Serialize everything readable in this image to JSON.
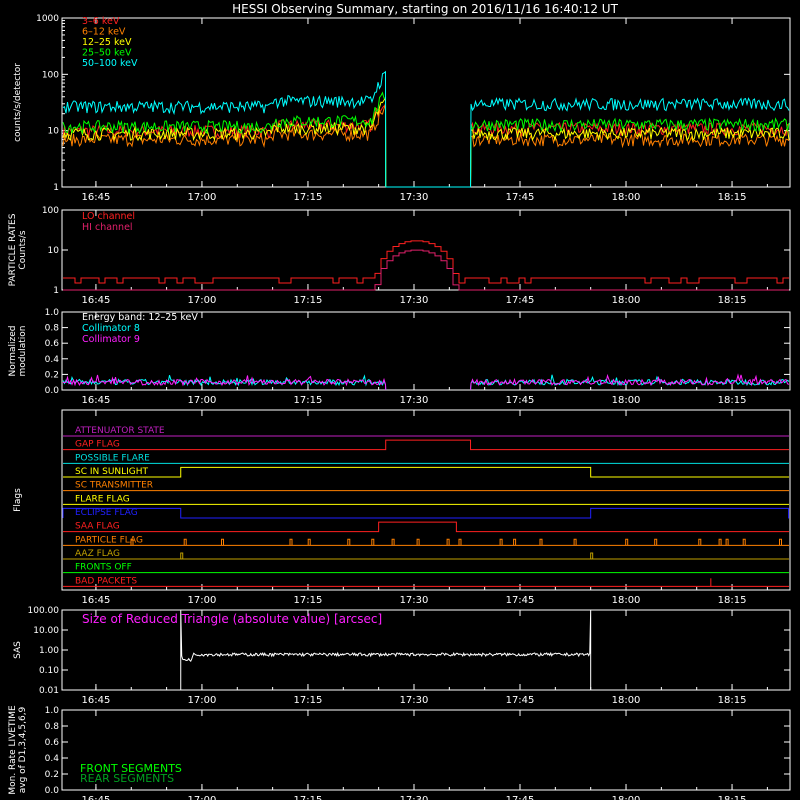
{
  "title": "HESSI Observing Summary, starting on 2016/11/16 16:40:12 UT",
  "x_tick_labels": [
    "16:45",
    "17:00",
    "17:15",
    "17:30",
    "17:45",
    "18:00",
    "18:15"
  ],
  "colors": {
    "c3_6": "#ff2020",
    "c6_12": "#ff8000",
    "c12_25": "#ffff00",
    "c25_50": "#00ff00",
    "c50_100": "#00ffff",
    "lo": "#ff2020",
    "hi": "#e0206a",
    "coll8": "#00ffff",
    "coll9": "#ff20ff",
    "white": "#ffffff",
    "flag_att": "#c020c0",
    "flag_gap": "#ff2020",
    "flag_poss": "#00e0e0",
    "flag_sun": "#ffff00",
    "flag_sct": "#ff8000",
    "flag_flare": "#ffff00",
    "flag_eclipse": "#2020ff",
    "flag_saa": "#ff2020",
    "flag_particle": "#ff8000",
    "flag_aaz": "#c0a000",
    "flag_fronts": "#00ff00",
    "flag_bad": "#ff2020",
    "front_seg": "#00ff00",
    "rear_seg": "#00a020"
  },
  "chart_data": [
    {
      "type": "line",
      "panel": "count rates",
      "ylabel": "counts/s/detector",
      "yscale": "log",
      "ylim": [
        1,
        1000
      ],
      "y_tick_labels": [
        "1",
        "10",
        "100",
        "1000"
      ],
      "x_range_minutes_from_start": [
        0,
        103
      ],
      "legend_position": "top-left",
      "series": [
        {
          "name": "3–6 keV",
          "color_key": "c3_6",
          "level_before": 10,
          "level_after": 11
        },
        {
          "name": "6–12 keV",
          "color_key": "c6_12",
          "level_before": 7,
          "level_after": 7
        },
        {
          "name": "12–25 keV",
          "color_key": "c12_25",
          "level_before": 9,
          "level_after": 9
        },
        {
          "name": "25–50 keV",
          "color_key": "c25_50",
          "level_before": 12,
          "level_after": 13
        },
        {
          "name": "50–100 keV",
          "color_key": "c50_100",
          "level_before": 27,
          "level_after": 30
        }
      ],
      "data_gap": [
        "17:26",
        "17:38"
      ]
    },
    {
      "type": "line",
      "panel": "particle rates",
      "ylabel_lines": [
        "PARTICLE RATES",
        "Counts/s"
      ],
      "yscale": "log",
      "ylim": [
        1,
        100
      ],
      "y_tick_labels": [
        "1",
        "10",
        "100"
      ],
      "legend_position": "top-left",
      "series": [
        {
          "name": "LO channel",
          "color_key": "lo",
          "baseline": 2,
          "peak": 17,
          "peak_time": "17:30"
        },
        {
          "name": "HI channel",
          "color_key": "hi",
          "baseline": 1,
          "peak": 10,
          "peak_time": "17:30"
        }
      ]
    },
    {
      "type": "line",
      "panel": "modulation",
      "ylabel_lines": [
        "Normalized",
        "modulation"
      ],
      "ylim": [
        0,
        1
      ],
      "y_tick_labels": [
        "0.0",
        "0.2",
        "0.4",
        "0.6",
        "0.8",
        "1.0"
      ],
      "annotation": "Energy band: 12–25 keV",
      "series": [
        {
          "name": "Collimator 8",
          "color_key": "coll8",
          "level": 0.1
        },
        {
          "name": "Collimator 9",
          "color_key": "coll9",
          "level": 0.1
        }
      ],
      "data_gap": [
        "17:26",
        "17:38"
      ]
    },
    {
      "type": "line",
      "panel": "flags",
      "ylabel": "Flags",
      "flags": [
        {
          "name": "ATTENUATOR STATE",
          "color_key": "flag_att",
          "on": []
        },
        {
          "name": "GAP FLAG",
          "color_key": "flag_gap",
          "on": [
            [
              "17:26",
              "17:38"
            ]
          ]
        },
        {
          "name": "POSSIBLE FLARE",
          "color_key": "flag_poss",
          "on": []
        },
        {
          "name": "SC IN SUNLIGHT",
          "color_key": "flag_sun",
          "on": [
            [
              "16:57",
              "17:55"
            ]
          ]
        },
        {
          "name": "SC TRANSMITTER",
          "color_key": "flag_sct",
          "on": []
        },
        {
          "name": "FLARE FLAG",
          "color_key": "flag_flare",
          "on": []
        },
        {
          "name": "ECLIPSE FLAG",
          "color_key": "flag_eclipse",
          "on": [
            [
              "16:40",
              "16:57"
            ],
            [
              "17:55",
              "18:23"
            ]
          ]
        },
        {
          "name": "SAA FLAG",
          "color_key": "flag_saa",
          "on": [
            [
              "17:25",
              "17:36"
            ]
          ]
        },
        {
          "name": "PARTICLE FLAG",
          "color_key": "flag_particle",
          "on": []
        },
        {
          "name": "AAZ FLAG",
          "color_key": "flag_aaz",
          "on": []
        },
        {
          "name": "FRONTS OFF",
          "color_key": "flag_fronts",
          "on": []
        },
        {
          "name": "BAD PACKETS",
          "color_key": "flag_bad",
          "on": []
        }
      ]
    },
    {
      "type": "line",
      "panel": "SAS",
      "ylabel": "SAS",
      "yscale": "log",
      "ylim": [
        0.01,
        100
      ],
      "y_tick_labels": [
        "0.01",
        "0.10",
        "1.00",
        "10.00",
        "100.00"
      ],
      "annotation": "Size of Reduced Triangle (absolute value) [arcsec]",
      "series": [
        {
          "name": "",
          "color_key": "white",
          "level": 0.6,
          "start": "16:57",
          "end": "17:55"
        }
      ]
    },
    {
      "type": "line",
      "panel": "livetime",
      "ylabel_lines": [
        "Mon. Rate LIVETIME",
        "avg of D1,3,4,5,6,9"
      ],
      "ylim": [
        0,
        1
      ],
      "y_tick_labels": [
        "0.0",
        "0.2",
        "0.4",
        "0.6",
        "0.8",
        "1.0"
      ],
      "series": [
        {
          "name": "FRONT SEGMENTS",
          "color_key": "front_seg"
        },
        {
          "name": "REAR SEGMENTS",
          "color_key": "rear_seg"
        }
      ]
    }
  ]
}
